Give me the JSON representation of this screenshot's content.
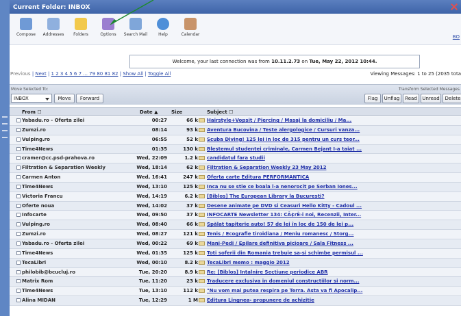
{
  "window": {
    "title": "Current Folder: INBOX"
  },
  "toolbar": {
    "items": [
      {
        "label": "Compose",
        "icon": "compose-icon"
      },
      {
        "label": "Addresses",
        "icon": "addresses-icon"
      },
      {
        "label": "Folders",
        "icon": "folders-icon"
      },
      {
        "label": "Options",
        "icon": "options-icon"
      },
      {
        "label": "Search Mail",
        "icon": "search-icon"
      },
      {
        "label": "Help",
        "icon": "help-icon"
      },
      {
        "label": "Calendar",
        "icon": "calendar-icon"
      }
    ],
    "right_link": "BO"
  },
  "welcome": {
    "prefix": "Welcome, your last connection was from ",
    "ip": "10.11.2.73",
    "mid": " on ",
    "date": "Tue, May 22, 2012 10:44."
  },
  "nav": {
    "previous": "Previous",
    "next": "Next",
    "pages": "1 2 3 4 5 6 7 ... 79 80 81 82",
    "show_all": "Show All",
    "toggle_all": "Toggle All",
    "viewing": "Viewing Messages: 1 to 25 (2035 tota"
  },
  "actions": {
    "move_label": "Move Selected To:",
    "transform_label": "Transform Selected Messages",
    "folder_value": "INBOX",
    "move_button": "Move",
    "forward_button": "Forward",
    "flag": "Flag",
    "unflag": "Unflag",
    "read": "Read",
    "unread": "Unread",
    "delete": "Delete"
  },
  "table": {
    "headers": {
      "from": "From",
      "date": "Date",
      "size": "Size",
      "subject": "Subject"
    },
    "rows": [
      {
        "from": "Yabadu.ro - Oferta zilei",
        "date": "00:27",
        "size": "66 k",
        "subject": "Hairstyle+Vopsit / Piercing / Masaj la domiciliu / Ma..."
      },
      {
        "from": "Zumzi.ro",
        "date": "08:14",
        "size": "93 k",
        "subject": "Aventura Bucovina / Teste alergologice / Cursuri vanza..."
      },
      {
        "from": "Vulping.ro",
        "date": "06:55",
        "size": "52 k",
        "subject": "Scuba Diving! 125 lei in loc de 315 pentru un curs teor..."
      },
      {
        "from": "Time4News",
        "date": "01:35",
        "size": "130 k",
        "subject": "Blestemul studentei criminale, Carmen Bejant I-a taiat ..."
      },
      {
        "from": "cramer@cc.psd-prahova.ro",
        "date": "Wed, 22:09",
        "size": "1.2 k",
        "subject": "candidatul fara studii"
      },
      {
        "from": "Filtration & Separation Weekly",
        "date": "Wed, 18:14",
        "size": "62 k",
        "subject": "Filtration & Separation Weekly 23 May 2012"
      },
      {
        "from": "Carmen Anton",
        "date": "Wed, 16:41",
        "size": "247 k",
        "subject": "Oferta carte Editura PERFORMANTICA"
      },
      {
        "from": "Time4News",
        "date": "Wed, 13:10",
        "size": "125 k",
        "subject": "Inca nu se stie ce boala l-a nenorocit pe Serban Iones..."
      },
      {
        "from": "Victoria Francu",
        "date": "Wed, 14:19",
        "size": "6.2 k",
        "subject": "[Biblos] The European Library la Bucuresti?"
      },
      {
        "from": "Oferte noua",
        "date": "Wed, 14:02",
        "size": "37 k",
        "subject": "Desene animate pe DVD si Ceasuri Hello Kitty - Cadoul ..."
      },
      {
        "from": "Infocarte",
        "date": "Wed, 09:50",
        "size": "37 k",
        "subject": "INFOCARTE Newsletter 134: CÃ¢rÈ›i noi, Recenzii, Inter..."
      },
      {
        "from": "Vulping.ro",
        "date": "Wed, 08:40",
        "size": "66 k",
        "subject": "Spălat tapiterie auto! 57 de lei în loc de 150 de lei p..."
      },
      {
        "from": "Zumzi.ro",
        "date": "Wed, 08:27",
        "size": "121 k",
        "subject": "Tenis / Ecografie tiroidiana / Meniu romanesc / Storg..."
      },
      {
        "from": "Yabadu.ro - Oferta zilei",
        "date": "Wed, 00:22",
        "size": "69 k",
        "subject": "Mani-Pedi / Epilare definitiva picioare / Sala Fitness ..."
      },
      {
        "from": "Time4News",
        "date": "Wed, 01:35",
        "size": "125 k",
        "subject": "Toti soferii din Romania trebuie sa-si schimbe permisul ..."
      },
      {
        "from": "TecaLibri",
        "date": "Wed, 00:10",
        "size": "8.2 k",
        "subject": "TecaLibri memo : maggio 2012"
      },
      {
        "from": "philobib@bcucluj.ro",
        "date": "Tue, 20:20",
        "size": "8.9 k",
        "subject": "Re: [Biblos] Intalnire Sectiune periodice ABR"
      },
      {
        "from": "Matrix Rom",
        "date": "Tue, 11:20",
        "size": "23 k",
        "subject": "Traducere exclusiva in domeniul constructiilor si norm..."
      },
      {
        "from": "Time4News",
        "date": "Tue, 13:10",
        "size": "112 k",
        "subject": "\"Nu vom mai putea respira pe Terra. Asta va fi Apocalip..."
      },
      {
        "from": "Alina MIDAN",
        "date": "Tue, 12:29",
        "size": "1 M",
        "subject": "Editura Lingnea- propunere de achizitie"
      }
    ]
  },
  "colors": {
    "title_bar": "#3e64a8",
    "link": "#1f2fa8",
    "arrow": "#1e8a2e"
  }
}
